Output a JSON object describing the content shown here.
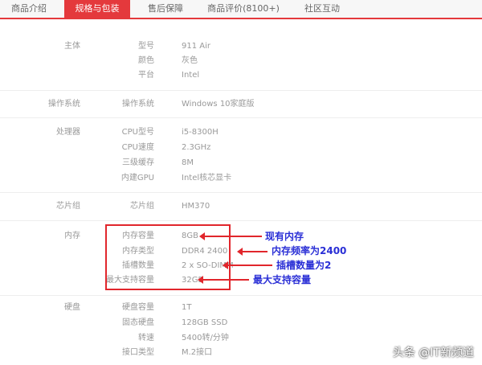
{
  "tabs": [
    {
      "label": "商品介绍"
    },
    {
      "label": "规格与包装"
    },
    {
      "label": "售后保障"
    },
    {
      "label": "商品评价(8100+)"
    },
    {
      "label": "社区互动"
    }
  ],
  "sections": [
    {
      "category": "主体",
      "rows": [
        {
          "key": "型号",
          "value": "911 Air"
        },
        {
          "key": "颜色",
          "value": "灰色"
        },
        {
          "key": "平台",
          "value": "Intel"
        }
      ]
    },
    {
      "category": "操作系统",
      "rows": [
        {
          "key": "操作系统",
          "value": "Windows 10家庭版"
        }
      ]
    },
    {
      "category": "处理器",
      "rows": [
        {
          "key": "CPU型号",
          "value": "i5-8300H"
        },
        {
          "key": "CPU速度",
          "value": "2.3GHz"
        },
        {
          "key": "三级缓存",
          "value": "8M"
        },
        {
          "key": "内建GPU",
          "value": "Intel核芯显卡"
        }
      ]
    },
    {
      "category": "芯片组",
      "rows": [
        {
          "key": "芯片组",
          "value": "HM370"
        }
      ]
    },
    {
      "category": "内存",
      "rows": [
        {
          "key": "内存容量",
          "value": "8GB"
        },
        {
          "key": "内存类型",
          "value": "DDR4 2400"
        },
        {
          "key": "插槽数量",
          "value": "2 x SO-DIMM"
        },
        {
          "key": "最大支持容量",
          "value": "32GB"
        }
      ]
    },
    {
      "category": "硬盘",
      "rows": [
        {
          "key": "硬盘容量",
          "value": "1T"
        },
        {
          "key": "固态硬盘",
          "value": "128GB SSD"
        },
        {
          "key": "转速",
          "value": "5400转/分钟"
        },
        {
          "key": "接口类型",
          "value": "M.2接口"
        }
      ]
    }
  ],
  "annotations": [
    {
      "text": "现有内存"
    },
    {
      "text": "内存频率为2400"
    },
    {
      "text": "插槽数量为2"
    },
    {
      "text": "最大支持容量"
    }
  ],
  "watermark": "头条 @IT新频道",
  "colors": {
    "accent": "#e4393c",
    "annotation_text": "#2a2fd6",
    "annotation_box": "#e1262c"
  }
}
